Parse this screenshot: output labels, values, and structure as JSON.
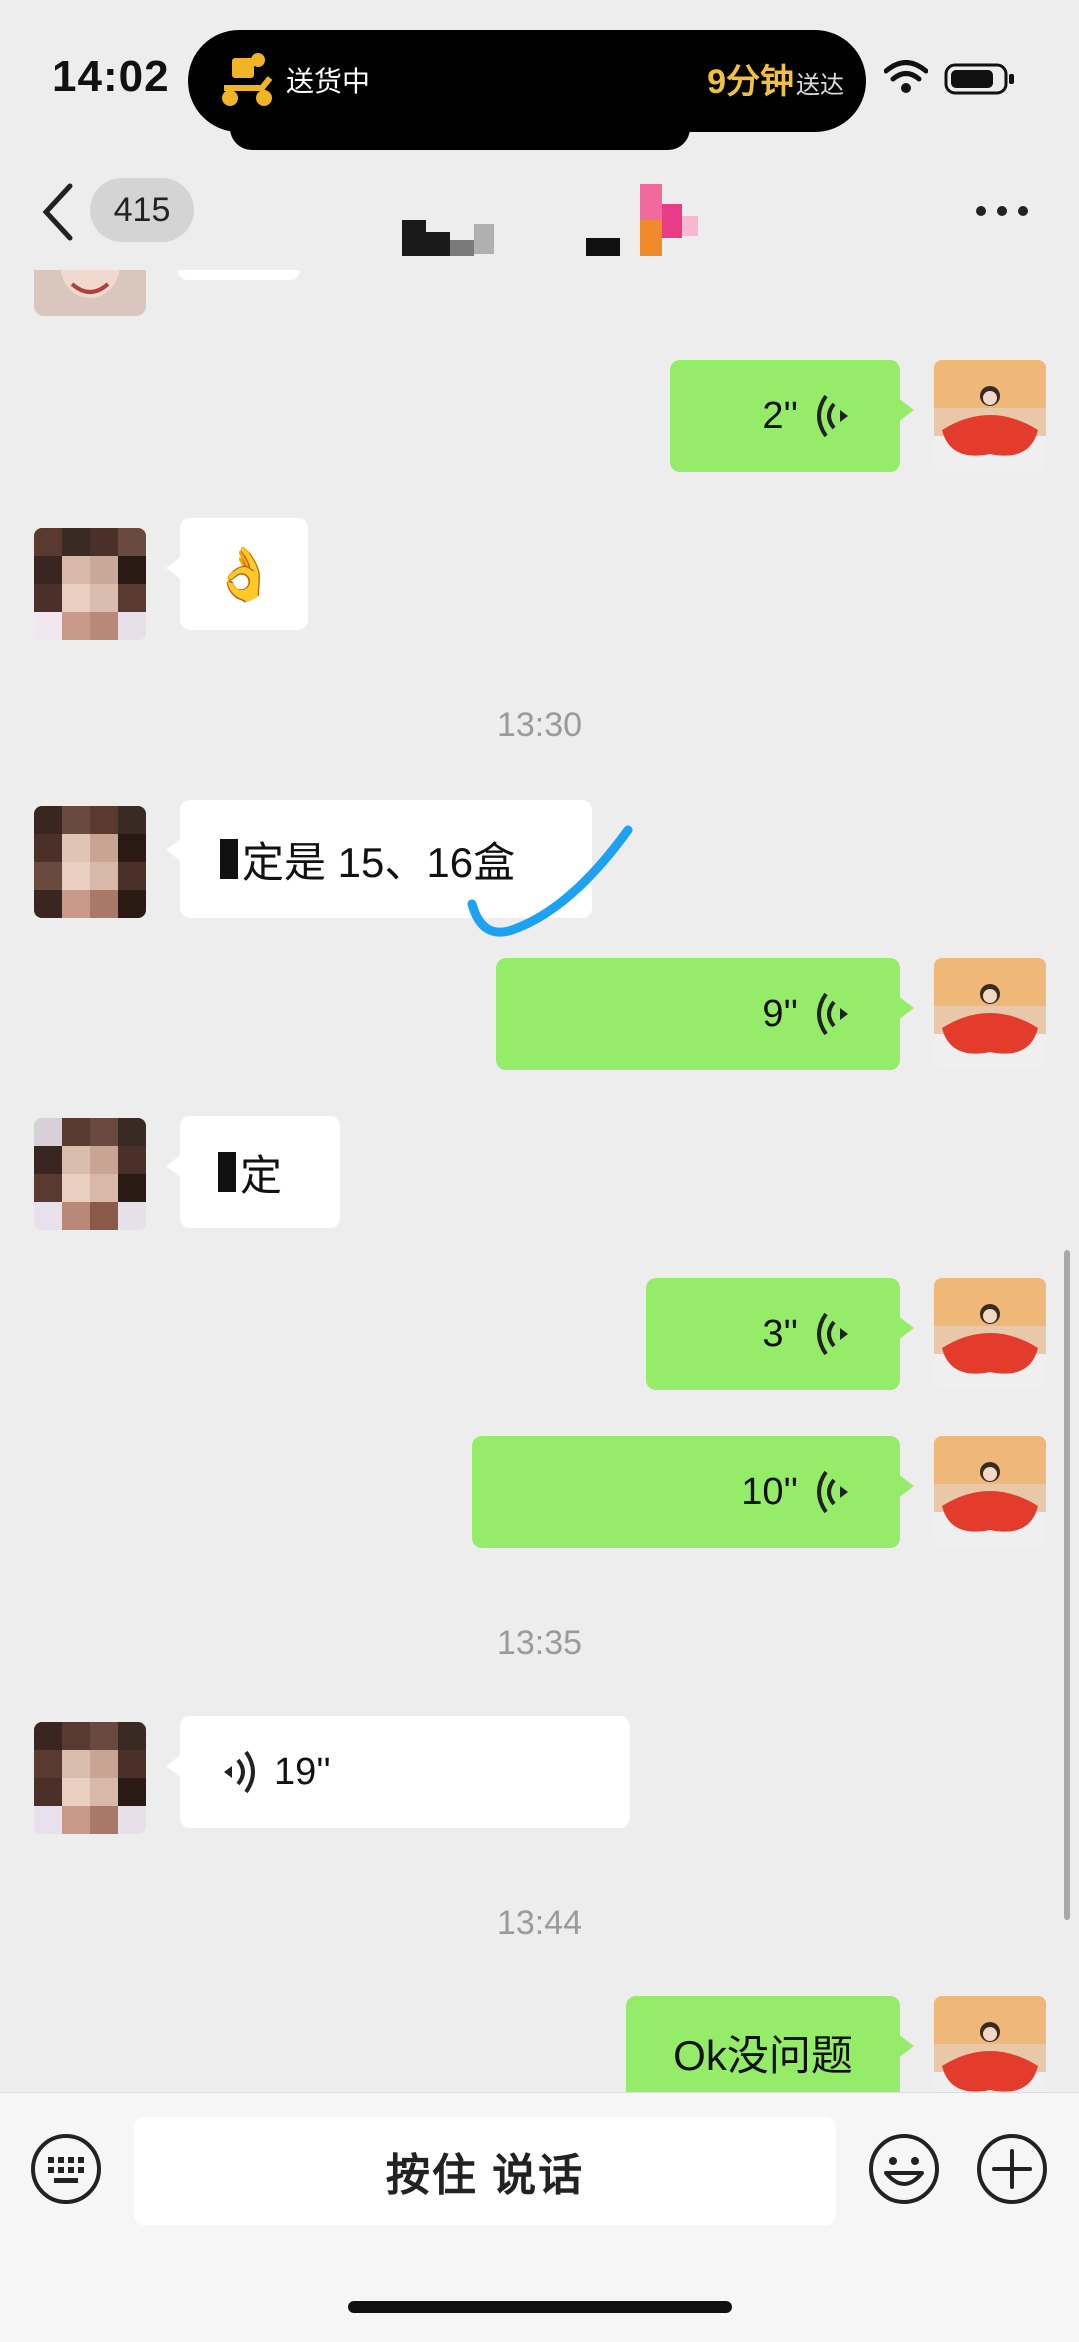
{
  "status_bar": {
    "time": "14:02",
    "island_status": "送货中",
    "eta_value": "9分钟",
    "eta_suffix": "送达"
  },
  "nav": {
    "unread_count": "415"
  },
  "messages": [
    {
      "type": "voice",
      "side": "out",
      "duration": "2''"
    },
    {
      "type": "emoji",
      "side": "in",
      "text": "👌"
    },
    {
      "type": "timestamp",
      "text": "13:30"
    },
    {
      "type": "text",
      "side": "in",
      "text": "定是 15、16盒"
    },
    {
      "type": "voice",
      "side": "out",
      "duration": "9''"
    },
    {
      "type": "text",
      "side": "in",
      "text": "定"
    },
    {
      "type": "voice",
      "side": "out",
      "duration": "3''"
    },
    {
      "type": "voice",
      "side": "out",
      "duration": "10''"
    },
    {
      "type": "timestamp",
      "text": "13:35"
    },
    {
      "type": "voice",
      "side": "in",
      "duration": "19''"
    },
    {
      "type": "timestamp",
      "text": "13:44"
    },
    {
      "type": "text",
      "side": "out",
      "text": "Ok没问题"
    }
  ],
  "input_bar": {
    "hold_to_talk_label": "按住 说话"
  },
  "colors": {
    "outgoing_bubble": "#95ec69",
    "incoming_bubble": "#ffffff",
    "background": "#ededed",
    "annotation_check": "#1da1f2"
  },
  "icons": [
    "back-arrow-icon",
    "more-icon",
    "voice-wave-icon",
    "keyboard-icon",
    "emoji-icon",
    "plus-icon",
    "wifi-icon",
    "battery-icon",
    "scooter-icon"
  ]
}
